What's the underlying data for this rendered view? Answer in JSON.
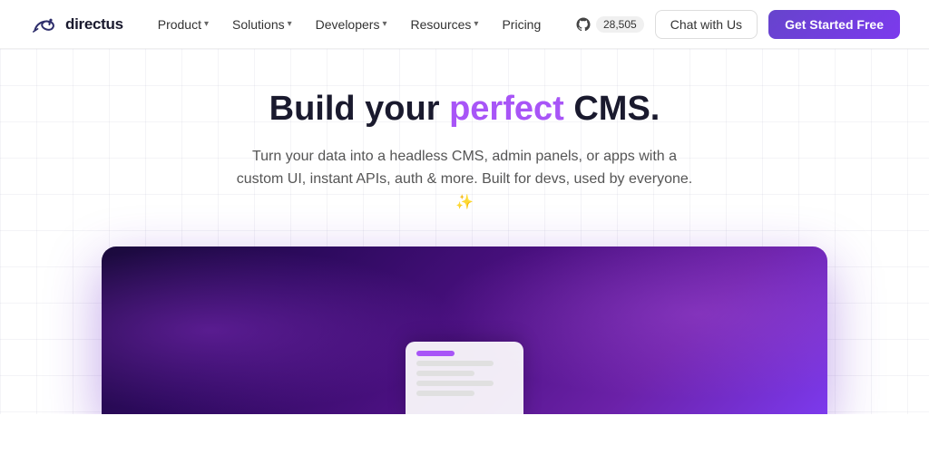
{
  "nav": {
    "logo_text": "directus",
    "links": [
      {
        "label": "Product",
        "has_dropdown": true
      },
      {
        "label": "Solutions",
        "has_dropdown": true
      },
      {
        "label": "Developers",
        "has_dropdown": true
      },
      {
        "label": "Resources",
        "has_dropdown": true
      },
      {
        "label": "Pricing",
        "has_dropdown": false
      }
    ],
    "github_count": "28,505",
    "chat_label": "Chat with Us",
    "cta_label": "Get Started Free"
  },
  "hero": {
    "title_part1": "Build your ",
    "title_highlight": "perfect",
    "title_part2": " CMS.",
    "subtitle": "Turn your data into a headless CMS, admin panels, or apps with a custom UI, instant APIs, auth & more. Built for devs, used by everyone. ✨"
  }
}
